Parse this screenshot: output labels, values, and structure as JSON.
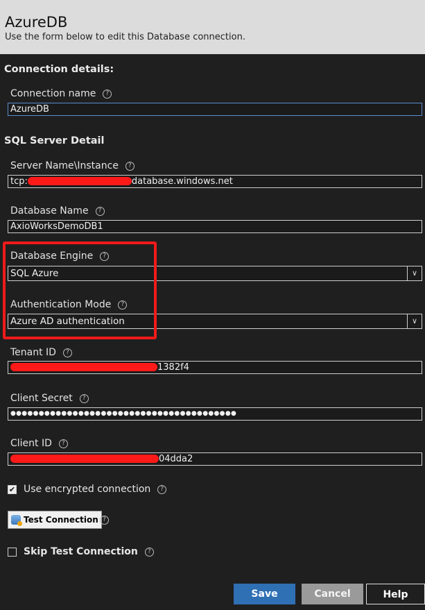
{
  "header": {
    "title": "AzureDB",
    "subtitle": "Use the form below to edit this Database connection."
  },
  "connection_details": {
    "heading": "Connection details:",
    "name_label": "Connection name",
    "name_value": "AzureDB"
  },
  "sql_server": {
    "heading": "SQL Server Detail",
    "server_label": "Server Name\\Instance",
    "server_prefix": "tcp:",
    "server_suffix": "database.windows.net",
    "db_label": "Database Name",
    "db_value": "AxioWorksDemoDB1",
    "engine_label": "Database Engine",
    "engine_value": "SQL Azure",
    "auth_label": "Authentication Mode",
    "auth_value": "Azure AD authentication",
    "tenant_label": "Tenant ID",
    "tenant_suffix": "1382f4",
    "secret_label": "Client Secret",
    "secret_value": "●●●●●●●●●●●●●●●●●●●●●●●●●●●●●●●●●●●●●●●●",
    "client_label": "Client ID",
    "client_suffix": "04dda2"
  },
  "options": {
    "encrypted_label": "Use encrypted connection",
    "encrypted_checked": true,
    "test_button": "Test Connection",
    "skip_label": "Skip Test Connection",
    "skip_checked": false
  },
  "footer": {
    "save": "Save",
    "cancel": "Cancel",
    "help": "Help"
  },
  "icons": {
    "help": "help-circle-icon",
    "dropdown": "chevron-down-icon",
    "check": "checkmark-icon",
    "database": "database-icon"
  },
  "colors": {
    "header_bg": "#dcdcdc",
    "body_bg": "#1f1f1f",
    "save_bg": "#2f6fb4",
    "cancel_bg": "#9a9a9a",
    "highlight": "#f01a1a",
    "redaction": "#ff1a1a"
  }
}
